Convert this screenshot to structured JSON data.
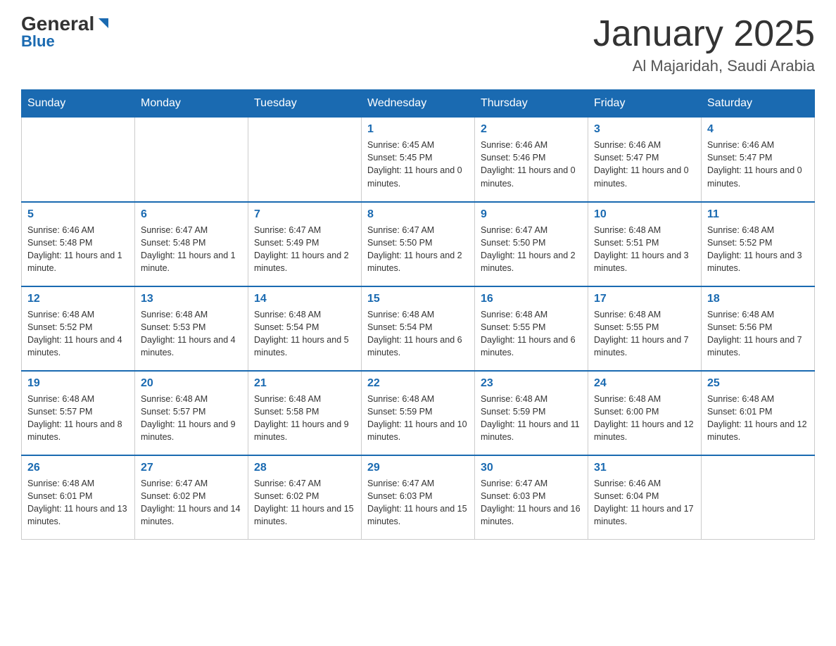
{
  "logo": {
    "general": "General",
    "blue": "Blue"
  },
  "header": {
    "month": "January 2025",
    "location": "Al Majaridah, Saudi Arabia"
  },
  "days_of_week": [
    "Sunday",
    "Monday",
    "Tuesday",
    "Wednesday",
    "Thursday",
    "Friday",
    "Saturday"
  ],
  "weeks": [
    [
      {
        "day": "",
        "info": ""
      },
      {
        "day": "",
        "info": ""
      },
      {
        "day": "",
        "info": ""
      },
      {
        "day": "1",
        "info": "Sunrise: 6:45 AM\nSunset: 5:45 PM\nDaylight: 11 hours and 0 minutes."
      },
      {
        "day": "2",
        "info": "Sunrise: 6:46 AM\nSunset: 5:46 PM\nDaylight: 11 hours and 0 minutes."
      },
      {
        "day": "3",
        "info": "Sunrise: 6:46 AM\nSunset: 5:47 PM\nDaylight: 11 hours and 0 minutes."
      },
      {
        "day": "4",
        "info": "Sunrise: 6:46 AM\nSunset: 5:47 PM\nDaylight: 11 hours and 0 minutes."
      }
    ],
    [
      {
        "day": "5",
        "info": "Sunrise: 6:46 AM\nSunset: 5:48 PM\nDaylight: 11 hours and 1 minute."
      },
      {
        "day": "6",
        "info": "Sunrise: 6:47 AM\nSunset: 5:48 PM\nDaylight: 11 hours and 1 minute."
      },
      {
        "day": "7",
        "info": "Sunrise: 6:47 AM\nSunset: 5:49 PM\nDaylight: 11 hours and 2 minutes."
      },
      {
        "day": "8",
        "info": "Sunrise: 6:47 AM\nSunset: 5:50 PM\nDaylight: 11 hours and 2 minutes."
      },
      {
        "day": "9",
        "info": "Sunrise: 6:47 AM\nSunset: 5:50 PM\nDaylight: 11 hours and 2 minutes."
      },
      {
        "day": "10",
        "info": "Sunrise: 6:48 AM\nSunset: 5:51 PM\nDaylight: 11 hours and 3 minutes."
      },
      {
        "day": "11",
        "info": "Sunrise: 6:48 AM\nSunset: 5:52 PM\nDaylight: 11 hours and 3 minutes."
      }
    ],
    [
      {
        "day": "12",
        "info": "Sunrise: 6:48 AM\nSunset: 5:52 PM\nDaylight: 11 hours and 4 minutes."
      },
      {
        "day": "13",
        "info": "Sunrise: 6:48 AM\nSunset: 5:53 PM\nDaylight: 11 hours and 4 minutes."
      },
      {
        "day": "14",
        "info": "Sunrise: 6:48 AM\nSunset: 5:54 PM\nDaylight: 11 hours and 5 minutes."
      },
      {
        "day": "15",
        "info": "Sunrise: 6:48 AM\nSunset: 5:54 PM\nDaylight: 11 hours and 6 minutes."
      },
      {
        "day": "16",
        "info": "Sunrise: 6:48 AM\nSunset: 5:55 PM\nDaylight: 11 hours and 6 minutes."
      },
      {
        "day": "17",
        "info": "Sunrise: 6:48 AM\nSunset: 5:55 PM\nDaylight: 11 hours and 7 minutes."
      },
      {
        "day": "18",
        "info": "Sunrise: 6:48 AM\nSunset: 5:56 PM\nDaylight: 11 hours and 7 minutes."
      }
    ],
    [
      {
        "day": "19",
        "info": "Sunrise: 6:48 AM\nSunset: 5:57 PM\nDaylight: 11 hours and 8 minutes."
      },
      {
        "day": "20",
        "info": "Sunrise: 6:48 AM\nSunset: 5:57 PM\nDaylight: 11 hours and 9 minutes."
      },
      {
        "day": "21",
        "info": "Sunrise: 6:48 AM\nSunset: 5:58 PM\nDaylight: 11 hours and 9 minutes."
      },
      {
        "day": "22",
        "info": "Sunrise: 6:48 AM\nSunset: 5:59 PM\nDaylight: 11 hours and 10 minutes."
      },
      {
        "day": "23",
        "info": "Sunrise: 6:48 AM\nSunset: 5:59 PM\nDaylight: 11 hours and 11 minutes."
      },
      {
        "day": "24",
        "info": "Sunrise: 6:48 AM\nSunset: 6:00 PM\nDaylight: 11 hours and 12 minutes."
      },
      {
        "day": "25",
        "info": "Sunrise: 6:48 AM\nSunset: 6:01 PM\nDaylight: 11 hours and 12 minutes."
      }
    ],
    [
      {
        "day": "26",
        "info": "Sunrise: 6:48 AM\nSunset: 6:01 PM\nDaylight: 11 hours and 13 minutes."
      },
      {
        "day": "27",
        "info": "Sunrise: 6:47 AM\nSunset: 6:02 PM\nDaylight: 11 hours and 14 minutes."
      },
      {
        "day": "28",
        "info": "Sunrise: 6:47 AM\nSunset: 6:02 PM\nDaylight: 11 hours and 15 minutes."
      },
      {
        "day": "29",
        "info": "Sunrise: 6:47 AM\nSunset: 6:03 PM\nDaylight: 11 hours and 15 minutes."
      },
      {
        "day": "30",
        "info": "Sunrise: 6:47 AM\nSunset: 6:03 PM\nDaylight: 11 hours and 16 minutes."
      },
      {
        "day": "31",
        "info": "Sunrise: 6:46 AM\nSunset: 6:04 PM\nDaylight: 11 hours and 17 minutes."
      },
      {
        "day": "",
        "info": ""
      }
    ]
  ],
  "colors": {
    "header_bg": "#1a6ab1",
    "accent": "#1a6ab1"
  }
}
